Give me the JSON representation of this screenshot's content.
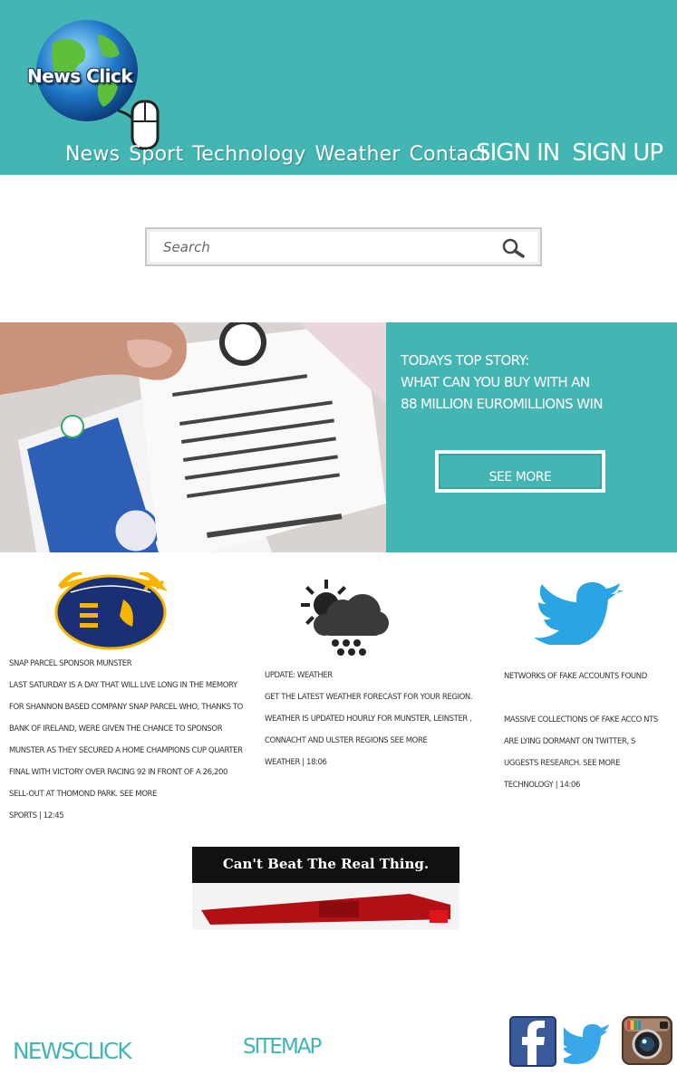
{
  "header": {
    "logo_text": "News Click",
    "nav": [
      "News",
      "Sport",
      "Technology",
      "Weather",
      "Contact"
    ],
    "sign_in": "SIGN IN",
    "sign_up": "SIGN UP"
  },
  "search": {
    "placeholder": "Search"
  },
  "top_story": {
    "line1": "Todays top story:",
    "line2": "What can you buy with an",
    "line3": "88 million Euromillions win",
    "button": "See more"
  },
  "columns": {
    "sport": {
      "title": "Snap Parcel sponsor Munster",
      "body": "Last Saturday is a day that will live long in the memory for Shannon based company Snap Parcel who, thanks to Bank of Ireland, were given the chance to sponsor Munster as they secured a Home Champions Cup quarter final with victory over Racing 92 in front of a 26,200 sell-out at Thomond Park. See more",
      "meta": "sports | 12:45"
    },
    "weather": {
      "title": "Update: Weather",
      "body": "Get the latest weather forecast for your region. Weather is updated hourly for Munster, Leinster , Connacht and Ulster regions see more",
      "meta": "weather | 18:06"
    },
    "tech": {
      "title": "Networks of fake accounts found",
      "body": "Massive collections of fake acco nts are lying dormant on Twitter, s uggests research. See more",
      "meta": "technology | 14:06"
    }
  },
  "ad": {
    "slogan": "Can't Beat The Real Thing."
  },
  "footer": {
    "brand": "NewsClick",
    "sitemap": "Sitemap"
  },
  "colors": {
    "accent": "#43b5b2",
    "text": "#333333"
  },
  "icons": [
    "search-icon",
    "munster-rugby-logo",
    "weather-cloud-icon",
    "twitter-icon",
    "facebook-icon",
    "instagram-icon"
  ]
}
